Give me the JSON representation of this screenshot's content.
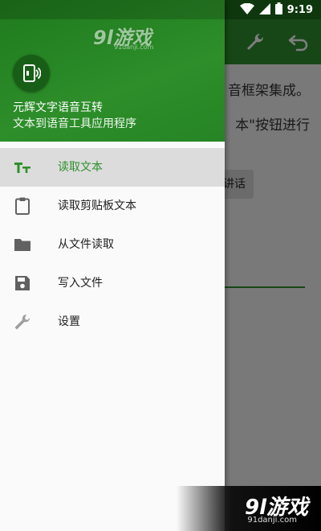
{
  "status_bar": {
    "time": "9:19",
    "icons": [
      "wifi-icon",
      "signal-icon",
      "battery-icon"
    ]
  },
  "background_app": {
    "toolbar_icons": [
      "wrench-icon",
      "undo-icon"
    ],
    "text_line_1": "音框架集成。",
    "text_line_2": "本\"按钮进行",
    "speak_button_label": "讲话"
  },
  "drawer": {
    "logo_icon": "tts-phone-icon",
    "app_name": "元辉文字语音互转",
    "app_description": "文本到语音工具应用程序",
    "menu_items": [
      {
        "label": "读取文本",
        "icon": "text-format-icon",
        "active": true
      },
      {
        "label": "读取剪贴板文本",
        "icon": "clipboard-icon",
        "active": false
      },
      {
        "label": "从文件读取",
        "icon": "folder-icon",
        "active": false
      },
      {
        "label": "写入文件",
        "icon": "save-icon",
        "active": false
      },
      {
        "label": "设置",
        "icon": "wrench-icon",
        "active": false
      }
    ]
  },
  "watermarks": {
    "brand": "9l游戏",
    "url": "91danji.com"
  },
  "colors": {
    "primary": "#2f8f2c",
    "primary_dark": "#1e6f1d",
    "drawer_bg": "#fafafa",
    "active_item_bg": "#dcdcdc"
  }
}
